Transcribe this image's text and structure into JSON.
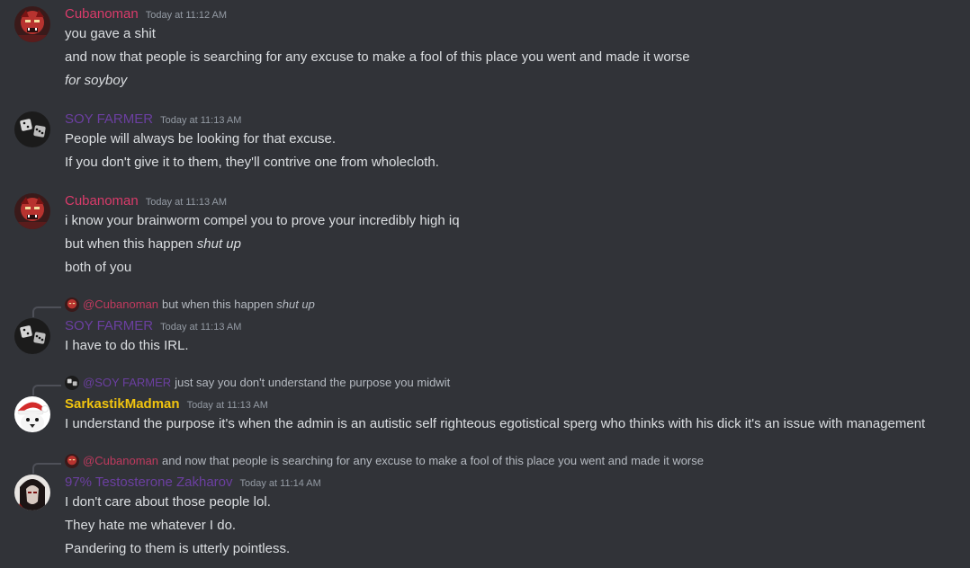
{
  "messages": [
    {
      "author": "Cubanoman",
      "timestamp": "Today at 11:12 AM",
      "lines": [
        "you gave a shit",
        "and now that people is searching for any excuse to make a fool of this place you went and made it worse"
      ],
      "italic_line": "for soyboy"
    },
    {
      "author": "SOY FARMER",
      "timestamp": "Today at 11:13 AM",
      "lines": [
        "People will always be looking for that excuse.",
        "If you don't give it to them, they'll contrive one from wholecloth."
      ]
    },
    {
      "author": "Cubanoman",
      "timestamp": "Today at 11:13 AM",
      "lines": [
        "i know your brainworm compel you to prove your incredibly high iq"
      ],
      "mixed_line": {
        "text": "but when this happen ",
        "italic": "shut up"
      },
      "last_line": "both of you"
    },
    {
      "reply": {
        "mention": "@Cubanoman",
        "text": "but when this happen ",
        "italic": "shut up"
      },
      "author": "SOY FARMER",
      "timestamp": "Today at 11:13 AM",
      "lines": [
        "I have to do this IRL."
      ]
    },
    {
      "reply": {
        "mention": "@SOY FARMER",
        "text": "just say you don't understand the purpose you midwit"
      },
      "author": "SarkastikMadman",
      "timestamp": "Today at 11:13 AM",
      "lines": [
        "I understand the purpose it's when the admin is an autistic self righteous egotistical sperg who thinks with his dick it's an issue with management"
      ]
    },
    {
      "reply": {
        "mention": "@Cubanoman",
        "text": "and now that people is searching for any excuse to make a fool of this place you went and made it worse"
      },
      "author": "97% Testosterone Zakharov",
      "timestamp": "Today at 11:14 AM",
      "lines": [
        "I don't care about those people lol.",
        "They hate me whatever I do.",
        "Pandering to them is utterly pointless."
      ]
    }
  ],
  "colors": {
    "background": "#313338",
    "cubanoman": "#d93b6a",
    "soy_farmer": "#6b3fa0",
    "sarkastik": "#f1c40f",
    "zakharov": "#6b3fa0"
  }
}
